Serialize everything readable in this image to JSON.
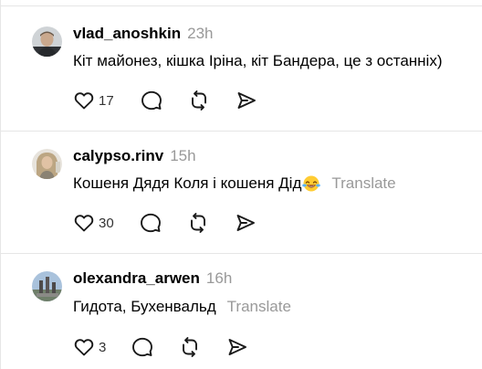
{
  "posts": [
    {
      "username": "vlad_anoshkin",
      "time": "23h",
      "text": "Кіт майонез, кішка Іріна, кіт Бандера, це з останніх)",
      "translate": "",
      "likes": "17",
      "avatar_icon": "user-avatar-man"
    },
    {
      "username": "calypso.rinv",
      "time": "15h",
      "text": "Кошеня Дядя Коля і кошеня Дід",
      "emoji": "face-with-tears-of-joy",
      "translate": "Translate",
      "likes": "30",
      "avatar_icon": "user-avatar-woman"
    },
    {
      "username": "olexandra_arwen",
      "time": "16h",
      "text": "Гидота, Бухенвальд",
      "translate": "Translate",
      "likes": "3",
      "avatar_icon": "user-avatar-landscape"
    }
  ],
  "icons": [
    "heart-icon",
    "comment-icon",
    "repost-icon",
    "share-icon"
  ],
  "colors": {
    "divider": "#e6e6e6",
    "muted": "#999999",
    "text": "#000000"
  }
}
